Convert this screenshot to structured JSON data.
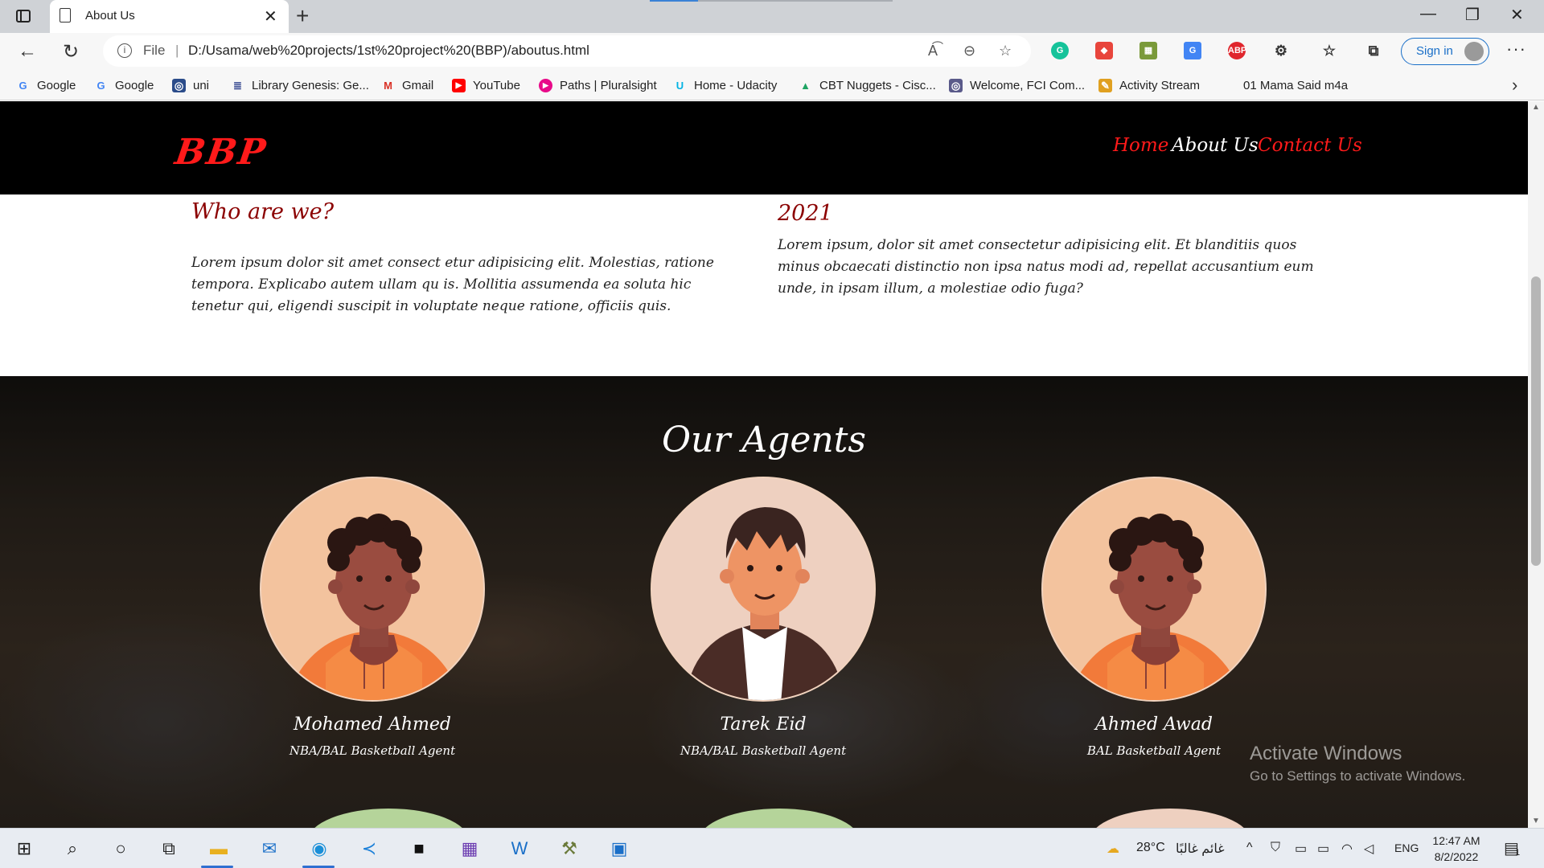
{
  "browser": {
    "tab_title": "About Us",
    "url_scheme": "File",
    "url": "D:/Usama/web%20projects/1st%20project%20(BBP)/aboutus.html",
    "sign_in": "Sign in"
  },
  "favorites": [
    {
      "label": "Google",
      "icon": "google-icon",
      "color": "#4285f4"
    },
    {
      "label": "Google",
      "icon": "google-icon",
      "color": "#4285f4"
    },
    {
      "label": "uni",
      "icon": "uni-icon",
      "color": "#2b4c8a"
    },
    {
      "label": "Library Genesis: Ge...",
      "icon": "library-icon",
      "color": "#2b3e8a"
    },
    {
      "label": "Gmail",
      "icon": "gmail-icon",
      "color": "#d93025"
    },
    {
      "label": "YouTube",
      "icon": "youtube-icon",
      "color": "#ff0000"
    },
    {
      "label": "Paths | Pluralsight",
      "icon": "pluralsight-icon",
      "color": "#e80a89"
    },
    {
      "label": "Home - Udacity",
      "icon": "udacity-icon",
      "color": "#02b3e4"
    },
    {
      "label": "CBT Nuggets - Cisc...",
      "icon": "drive-icon",
      "color": "#1fa463"
    },
    {
      "label": "Welcome, FCI Com...",
      "icon": "fci-icon",
      "color": "#5a5a8a"
    },
    {
      "label": "Activity Stream",
      "icon": "activity-icon",
      "color": "#e0a020"
    },
    {
      "label": "01 Mama Said m4a",
      "icon": "",
      "color": ""
    }
  ],
  "site": {
    "logo": "BBP",
    "nav": [
      {
        "label": "Home",
        "color": "#ff1a1a"
      },
      {
        "label": "About Us",
        "color": "#ffffff"
      },
      {
        "label": "Contact Us",
        "color": "#ff1a1a"
      }
    ]
  },
  "about": {
    "left_title": "Who are we?",
    "left_text": "Lorem ipsum dolor sit amet consect etur adipisicing elit. Molestias, ratione tempora. Explicabo autem ullam qu is. Mollitia assumenda ea soluta hic tenetur qui, eligendi suscipit in voluptate neque ratione, officiis quis.",
    "right_title": "2021",
    "right_text": "Lorem ipsum, dolor sit amet consectetur adipisicing elit. Et blanditiis quos minus obcaecati distinctio non ipsa natus modi ad, repellat accusantium eum unde, in ipsam illum, a molestiae odio fuga?"
  },
  "agents": {
    "title": "Our Agents",
    "list": [
      {
        "name": "Mohamed Ahmed",
        "role": "NBA/BAL Basketball Agent"
      },
      {
        "name": "Tarek Eid",
        "role": "NBA/BAL Basketball Agent"
      },
      {
        "name": "Ahmed Awad",
        "role": "BAL Basketball Agent"
      }
    ]
  },
  "watermark": {
    "line1": "Activate Windows",
    "line2": "Go to Settings to activate Windows."
  },
  "taskbar": {
    "temperature": "28°C",
    "weather": "غائم غالبًا",
    "language": "ENG",
    "time": "12:47 AM",
    "date": "8/2/2022",
    "notification_count": "1"
  },
  "colors": {
    "brand_red": "#ff1a1a",
    "title_darkred": "#8b0000",
    "header_bg": "#000000"
  }
}
